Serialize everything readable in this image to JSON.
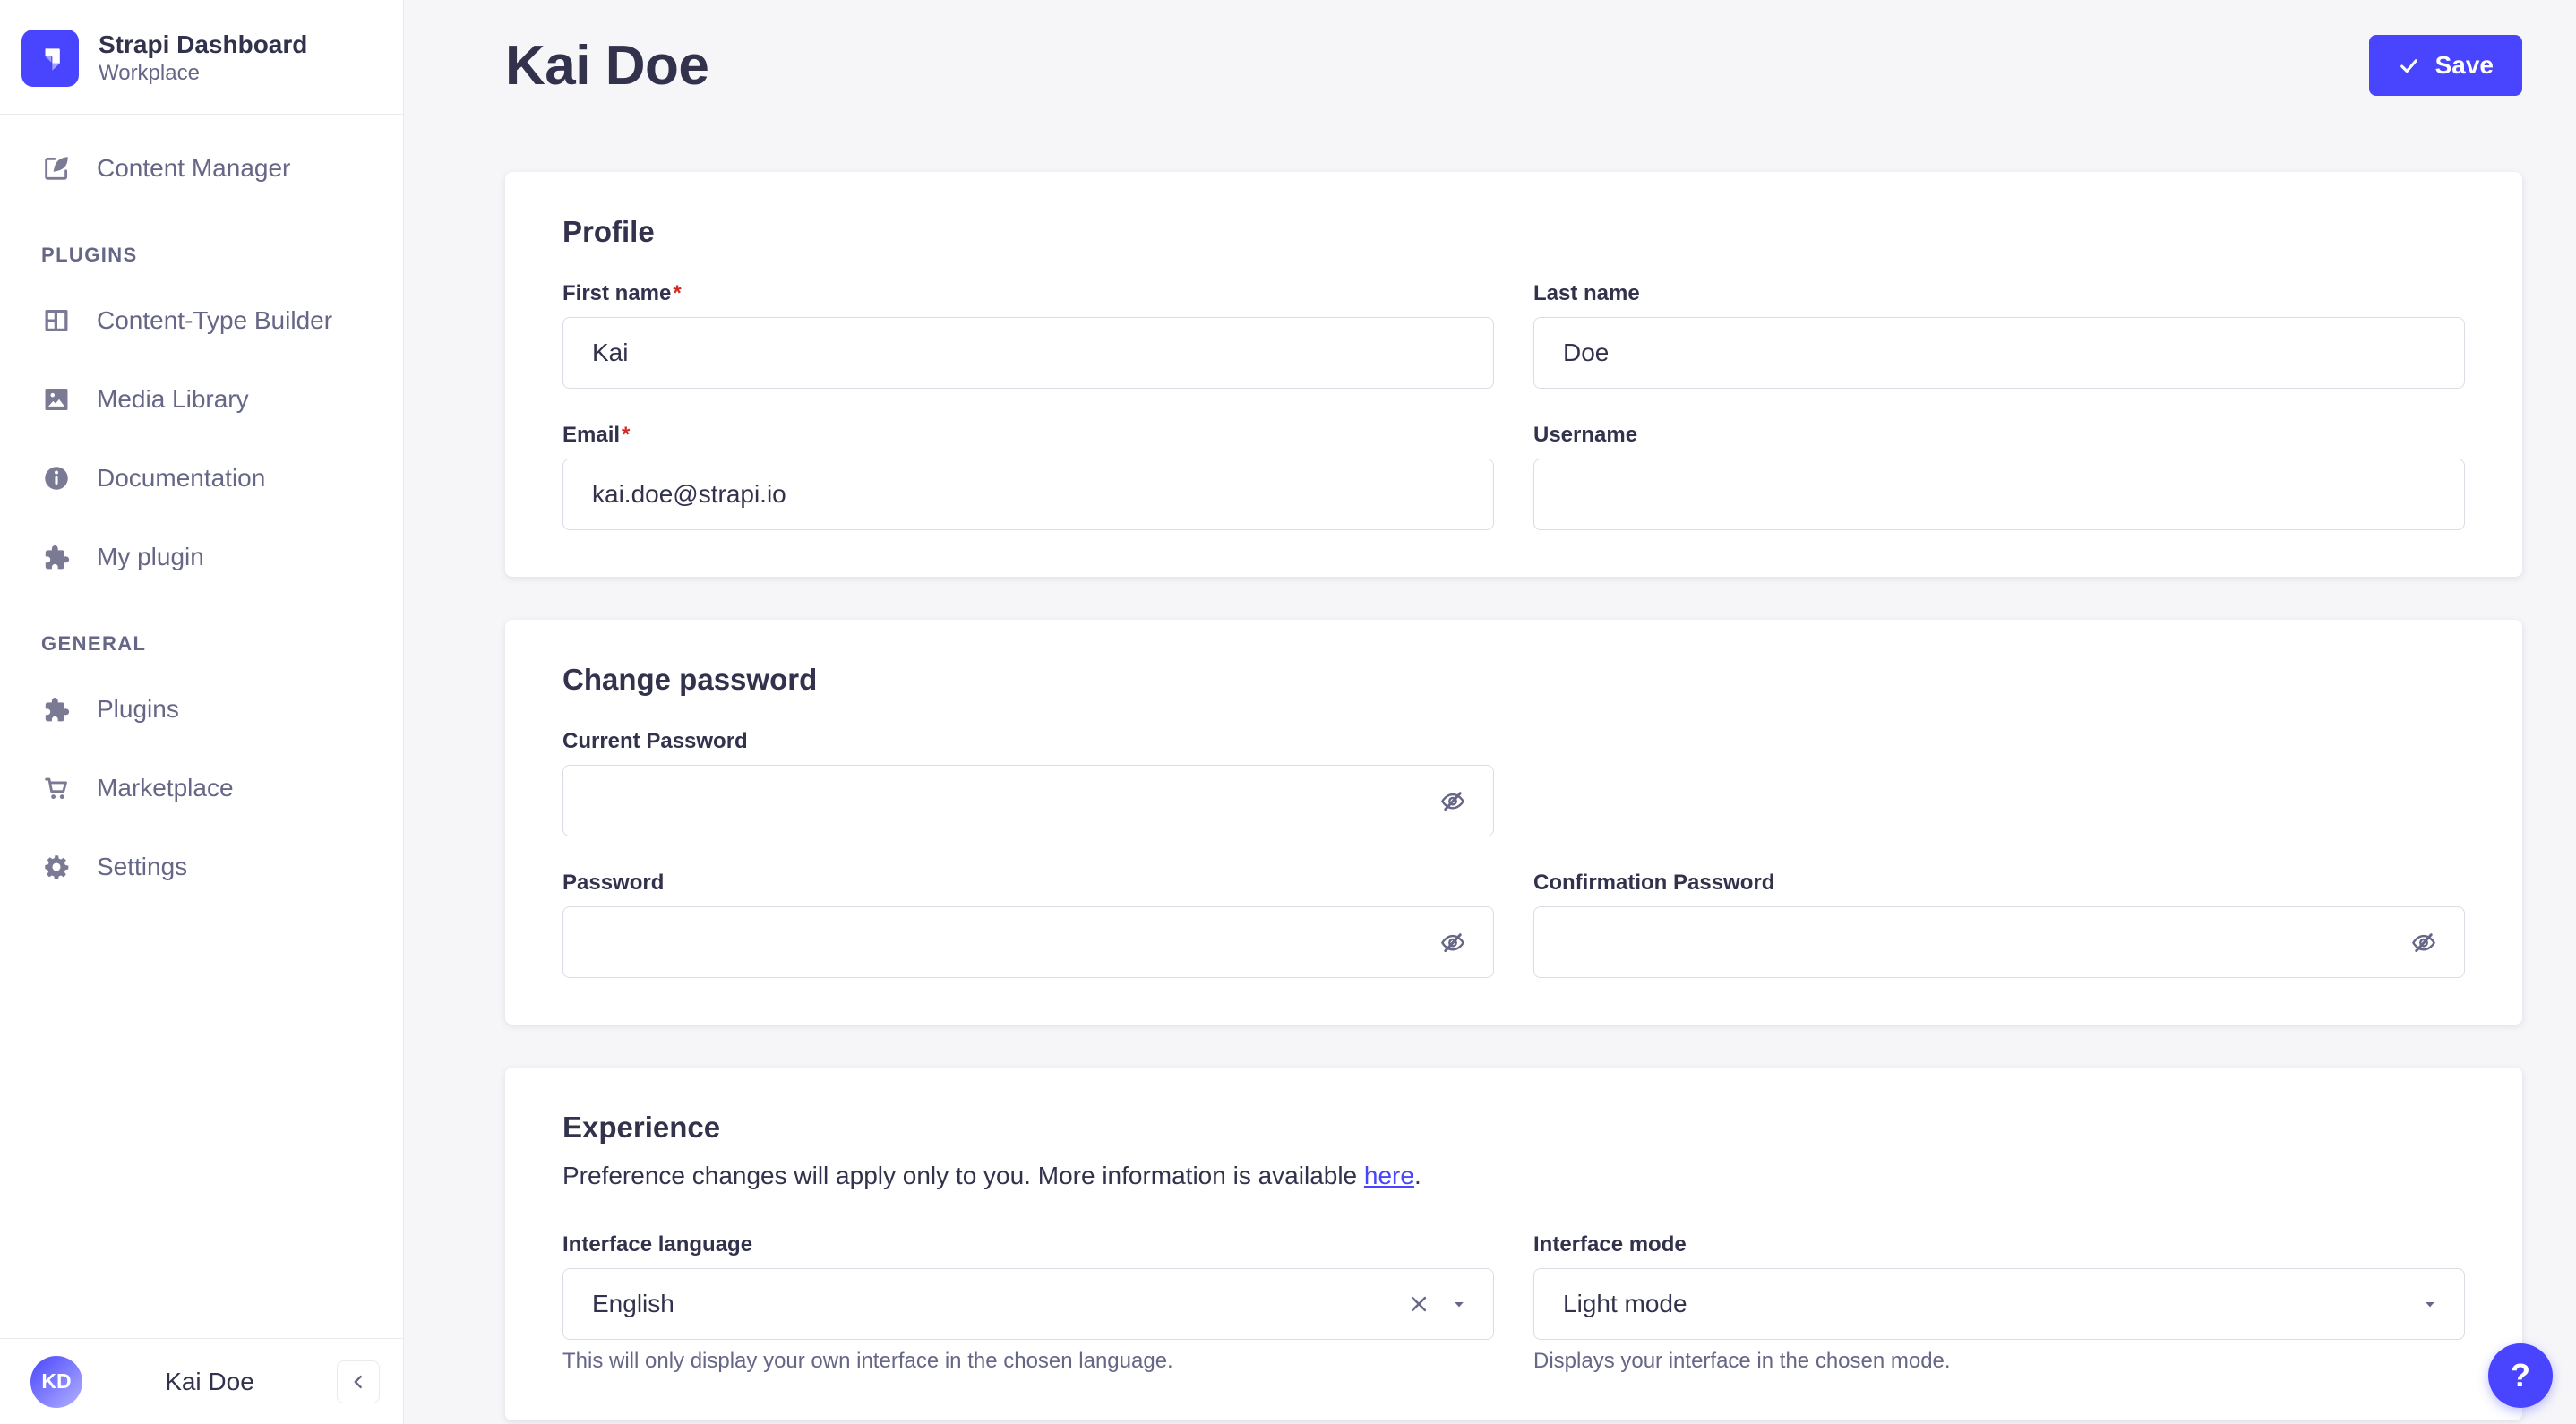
{
  "ui": {
    "required_marker": "*"
  },
  "colors": {
    "primary": "#4945ff",
    "danger": "#d02b20",
    "text": "#32324d",
    "muted": "#666687",
    "border": "#dcdce4",
    "background": "#f6f6f9"
  },
  "sidebar": {
    "brand": {
      "title": "Strapi Dashboard",
      "subtitle": "Workplace"
    },
    "items_top": [
      {
        "label": "Content Manager",
        "icon": "content-manager-icon"
      }
    ],
    "sections": [
      {
        "label": "PLUGINS",
        "items": [
          {
            "label": "Content-Type Builder",
            "icon": "content-type-builder-icon"
          },
          {
            "label": "Media Library",
            "icon": "media-library-icon"
          },
          {
            "label": "Documentation",
            "icon": "documentation-icon"
          },
          {
            "label": "My plugin",
            "icon": "puzzle-icon"
          }
        ]
      },
      {
        "label": "GENERAL",
        "items": [
          {
            "label": "Plugins",
            "icon": "puzzle-icon"
          },
          {
            "label": "Marketplace",
            "icon": "cart-icon"
          },
          {
            "label": "Settings",
            "icon": "gear-icon"
          }
        ]
      }
    ],
    "user": {
      "initials": "KD",
      "name": "Kai Doe"
    }
  },
  "header": {
    "title": "Kai Doe",
    "save_button": "Save"
  },
  "cards": {
    "profile": {
      "title": "Profile",
      "first_name": {
        "label": "First name",
        "value": "Kai"
      },
      "last_name": {
        "label": "Last name",
        "value": "Doe"
      },
      "email": {
        "label": "Email",
        "value": "kai.doe@strapi.io"
      },
      "username": {
        "label": "Username",
        "value": ""
      }
    },
    "password": {
      "title": "Change password",
      "current": {
        "label": "Current Password",
        "value": ""
      },
      "new": {
        "label": "Password",
        "value": ""
      },
      "confirmation": {
        "label": "Confirmation Password",
        "value": ""
      }
    },
    "experience": {
      "title": "Experience",
      "description": "Preference changes will apply only to you. More information is available ",
      "link_text": "here",
      "description_suffix": ".",
      "language": {
        "label": "Interface language",
        "value": "English",
        "helper": "This will only display your own interface in the chosen language."
      },
      "mode": {
        "label": "Interface mode",
        "value": "Light mode",
        "helper": "Displays your interface in the chosen mode."
      }
    }
  },
  "help_button": {
    "label": "?"
  }
}
